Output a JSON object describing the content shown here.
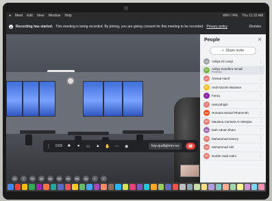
{
  "menubar": {
    "items": [
      "Meet",
      "Edit",
      "View",
      "Window",
      "Help"
    ],
    "status_text": "WIFI 74%",
    "clock": "Thu 11:22 AM"
  },
  "banner": {
    "title": "Recording has started.",
    "message": "This meeting is being recorded. By joining, you are giving consent for this meeting to be recorded.",
    "link": "Privacy policy",
    "dismiss": "Dismiss"
  },
  "controls": {
    "time": "0:03",
    "meeting_code": "hvp-qudbghms-na",
    "end_icon": "phone-hangup-icon"
  },
  "people": {
    "title": "People",
    "share_label": "Share invite",
    "participants": [
      {
        "initials": "AS",
        "name": "Aditya Ali Langi",
        "sub": "",
        "color": "#9aa0a6"
      },
      {
        "initials": "AG",
        "name": "Aditya Gandhra Ismaiil",
        "sub": "Presenter",
        "color": "#7cb342"
      },
      {
        "initials": "AH",
        "name": "Ahmad Hanif",
        "sub": "",
        "color": "#e67c73"
      },
      {
        "initials": "AH",
        "name": "Andi Nazam Maulana",
        "sub": "",
        "color": "#f6bf26"
      },
      {
        "initials": "F",
        "name": "Faruq",
        "sub": "",
        "color": "#8e24aa"
      },
      {
        "initials": "H",
        "name": "Hamzahijah",
        "sub": "",
        "color": "#e67c73"
      },
      {
        "initials": "HM",
        "name": "Humaira Mustof Rhammah",
        "sub": "",
        "color": "#f4511e"
      },
      {
        "initials": "MC",
        "name": "Maulana Camaria Ar Marajaa",
        "sub": "",
        "color": "#e67c73"
      },
      {
        "initials": "MA",
        "name": "Moh Adnan Ilham",
        "sub": "",
        "color": "#9e69af"
      },
      {
        "initials": "MH",
        "name": "Muhammad Hamzy",
        "sub": "",
        "color": "#e67c73"
      },
      {
        "initials": "MA",
        "name": "Muhammad Akil",
        "sub": "",
        "color": "#e67c73"
      },
      {
        "initials": "NA",
        "name": "Nurfah Hadi Hafni",
        "sub": "",
        "color": "#e67c73"
      }
    ]
  },
  "bubbles": [
    "AS",
    "T",
    "PH",
    "MI",
    "MH",
    "HM",
    "NH",
    "NH",
    "NA",
    "F",
    "P"
  ],
  "dock_colors": [
    "#4285f4",
    "#ea4335",
    "#fbbc05",
    "#34a853",
    "#9c27b0",
    "#ff7043",
    "#26a69a",
    "#5c6bc0",
    "#ef5350",
    "#ffca28",
    "#66bb6a",
    "#42a5f5",
    "#ab47bc",
    "#ff8a65",
    "#8d6e63",
    "#29b6f6",
    "#d4e157",
    "#ec407a",
    "#7e57c2",
    "#26c6da",
    "#ffa726",
    "#9ccc65",
    "#5c6bc0",
    "#ef5350",
    "#bdbdbd",
    "#90a4ae",
    "#c5e1a5",
    "#ffe082",
    "#b39ddb",
    "#80cbc4",
    "#ffab91",
    "#a5d6a7",
    "#fff59d",
    "#ce93d8",
    "#81d4fa",
    "#f48fb1"
  ]
}
